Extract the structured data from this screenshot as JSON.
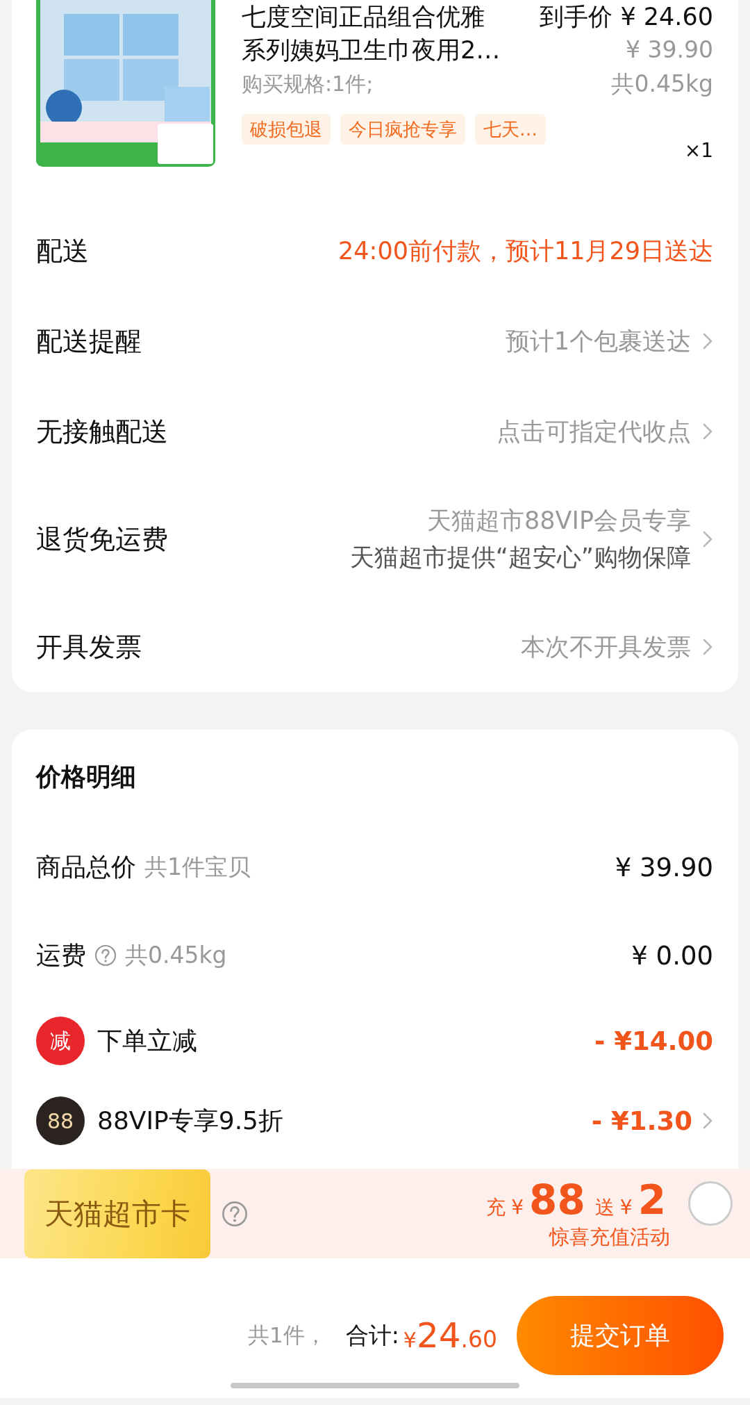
{
  "product": {
    "image": {
      "kind": "picture"
    },
    "title_lines": [
      "七度空间正品组合优雅",
      "系列姨妈卫生巾夜用2…"
    ],
    "deal_price": "到手价 ¥ 24.60",
    "original_price": "¥ 39.90",
    "weight": "共0.45kg",
    "spec": "购买规格:1件;",
    "tags": [
      "破损包退",
      "今日疯抢专享",
      "七天…"
    ],
    "quantity": "×1"
  },
  "delivery_rows": [
    {
      "kind": "highlight",
      "label": "配送",
      "values": [
        "24:00前付款，预计11月29日送达"
      ]
    },
    {
      "kind": "link",
      "label": "配送提醒",
      "values": [
        "预计1个包裹送达"
      ]
    },
    {
      "kind": "link",
      "label": "无接触配送",
      "values": [
        "点击可指定代收点"
      ]
    },
    {
      "kind": "link",
      "label": "退货免运费",
      "values": [
        "天猫超市88VIP会员专享",
        "天猫超市提供“超安心”购物保障"
      ]
    },
    {
      "kind": "link",
      "label": "开具发票",
      "values": [
        "本次不开具发票"
      ]
    }
  ],
  "price_details": {
    "title": "价格明细",
    "lines": [
      {
        "kind": "plain",
        "label": "商品总价",
        "note": "共1件宝贝",
        "amount": "¥ 39.90"
      },
      {
        "kind": "help",
        "label": "运费",
        "note": "共0.45kg",
        "amount": "¥ 0.00"
      },
      {
        "kind": "discount",
        "badge": "减",
        "label": "下单立减",
        "amount": "- ¥14.00"
      },
      {
        "kind": "vip",
        "badge": "88",
        "label": "88VIP专享9.5折",
        "amount": "- ¥1.30"
      }
    ]
  },
  "promo": {
    "card_label": "天猫超市卡",
    "offer": [
      {
        "kind": "label",
        "text": "充"
      },
      {
        "kind": "currency",
        "text": "¥"
      },
      {
        "kind": "amount",
        "text": "88"
      },
      {
        "kind": "label",
        "text": "送"
      },
      {
        "kind": "currency",
        "text": "¥"
      },
      {
        "kind": "amount",
        "text": "2"
      }
    ],
    "subtitle": "惊喜充值活动",
    "selected": false
  },
  "checkout": {
    "count": "共1件，",
    "total_label": "合计:",
    "currency": "¥",
    "total_integer": "24",
    "total_decimal": ".60",
    "submit": "提交订单"
  }
}
